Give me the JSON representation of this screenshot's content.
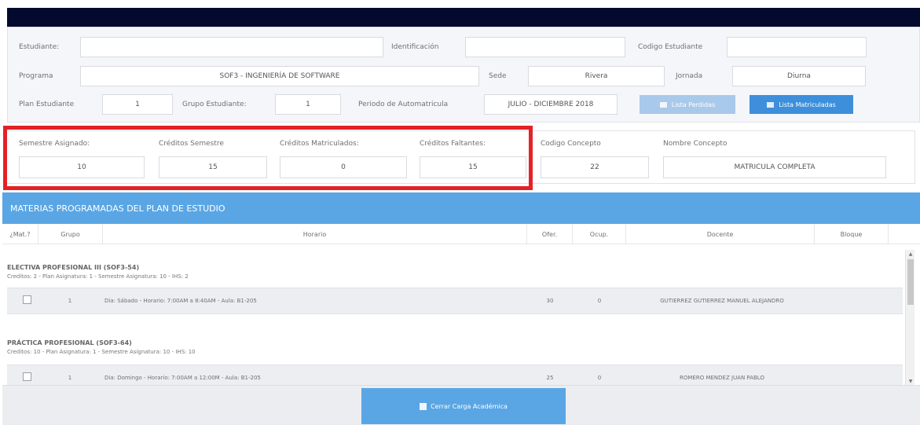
{
  "student": {
    "estudiante_label": "Estudiante:",
    "estudiante_value": "",
    "identificacion_label": "Identificación",
    "identificacion_value": "",
    "codigo_label": "Codigo Estudiante",
    "codigo_value": "",
    "programa_label": "Programa",
    "programa_value": "SOF3 - INGENIERÍA DE SOFTWARE",
    "sede_label": "Sede",
    "sede_value": "Rivera",
    "jornada_label": "Jornada",
    "jornada_value": "Diurna",
    "plan_label": "Plan Estudiante",
    "plan_value": "1",
    "grupo_label": "Grupo Estudiante:",
    "grupo_value": "1",
    "periodo_label": "Periodo de Automatricula",
    "periodo_value": "JULIO - DICIEMBRE 2018",
    "btn_perdidas": "Lista Perdidas",
    "btn_matriculadas": "Lista Matriculadas"
  },
  "stats": {
    "semestre_label": "Semestre Asignado:",
    "semestre_value": "10",
    "creditos_sem_label": "Créditos Semestre",
    "creditos_sem_value": "15",
    "creditos_mat_label": "Créditos Matriculados:",
    "creditos_mat_value": "0",
    "creditos_falt_label": "Créditos Faltantes:",
    "creditos_falt_value": "15",
    "codigo_concepto_label": "Codigo Concepto",
    "codigo_concepto_value": "22",
    "nombre_concepto_label": "Nombre Concepto",
    "nombre_concepto_value": "MATRICULA COMPLETA"
  },
  "materias": {
    "header": "MATERIAS PROGRAMADAS DEL PLAN DE ESTUDIO",
    "columns": [
      "¿Mat.?",
      "Grupo",
      "Horario",
      "Ofer.",
      "Ocup.",
      "Docente",
      "Bloque"
    ],
    "groups": [
      {
        "title": "ELECTIVA PROFESIONAL III (SOF3-54)",
        "subtitle": "Creditos: 2 - Plan Asignatura: 1 - Semestre Asignatura: 10 - IHS: 2",
        "row": {
          "grupo": "1",
          "horario": "Dia: Sábado - Horario: 7:00AM a 8:40AM - Aula: B1-205",
          "ofer": "30",
          "ocup": "0",
          "docente": "GUTIERREZ GUTIERREZ MANUEL ALEJANDRO",
          "bloque": ""
        }
      },
      {
        "title": "PRÁCTICA PROFESIONAL (SOF3-64)",
        "subtitle": "Creditos: 10 - Plan Asignatura: 1 - Semestre Asignatura: 10 - IHS: 10",
        "row": {
          "grupo": "1",
          "horario": "Dia: Domingo - Horario: 7:00AM a 12:00M - Aula: B1-205",
          "ofer": "25",
          "ocup": "0",
          "docente": "ROMERO MENDEZ JUAN PABLO",
          "bloque": ""
        }
      }
    ],
    "close_button": "Cerrar Carga Académica"
  }
}
